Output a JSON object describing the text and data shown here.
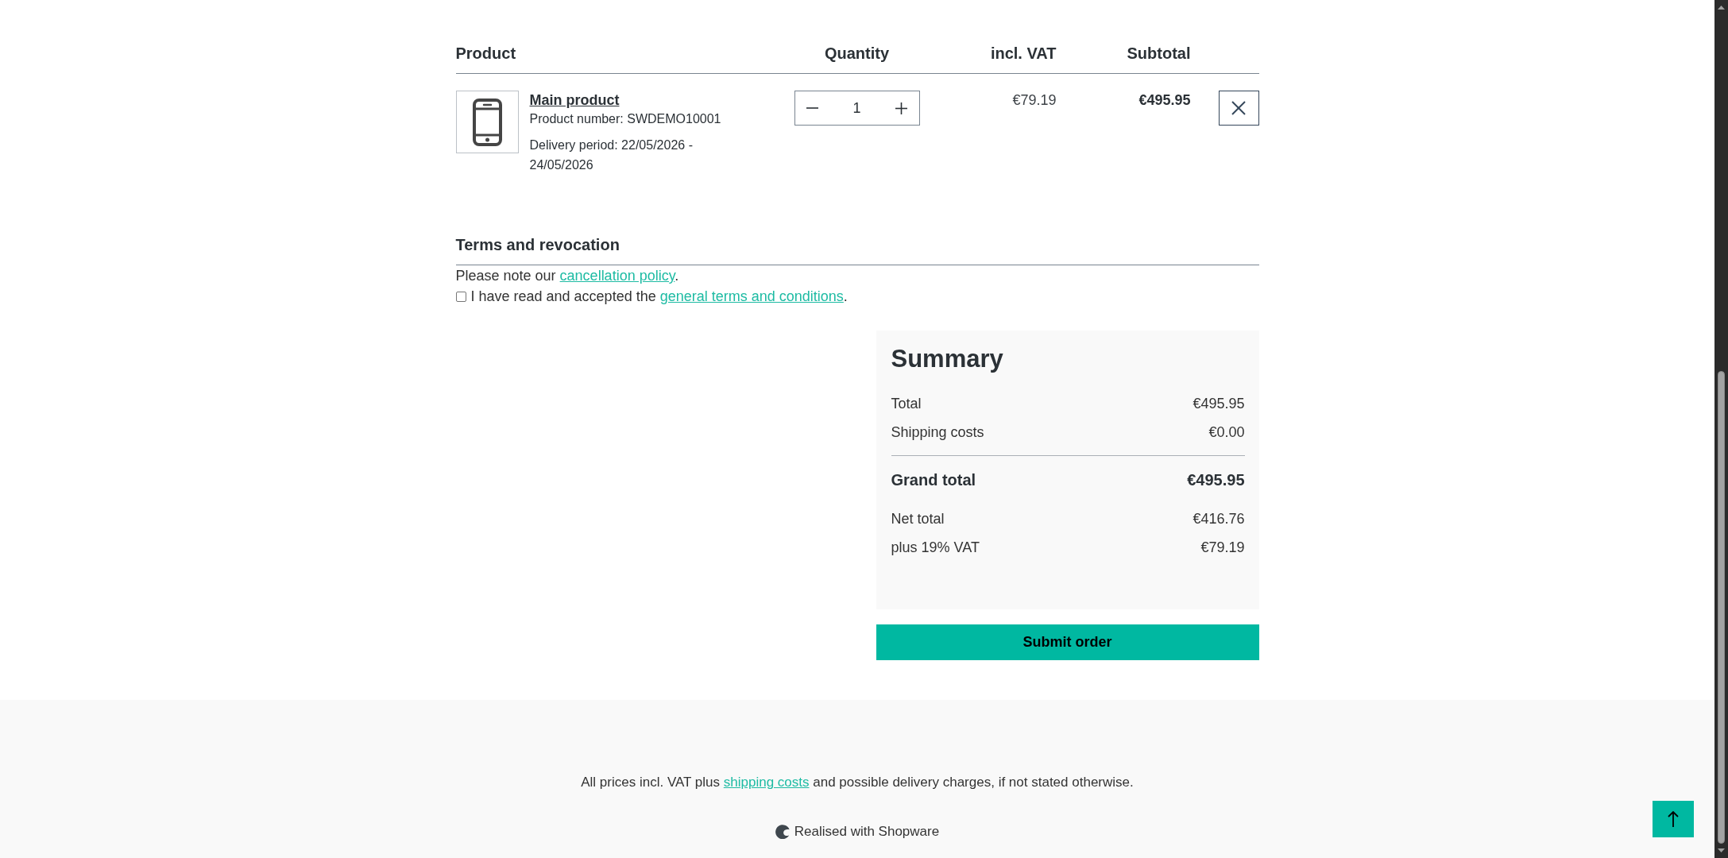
{
  "cart_table": {
    "columns": [
      "Product",
      "Quantity",
      "incl. VAT",
      "Subtotal"
    ],
    "items": [
      {
        "name": "Main product",
        "product_number": "Product number: SWDEMO10001",
        "delivery_period": "Delivery period: 22/05/2026 - 24/05/2026",
        "quantity": "1",
        "price_incl_vat": "€79.19",
        "subtotal": "€495.95"
      }
    ]
  },
  "terms": {
    "title": "Terms and revocation",
    "notice": {
      "before": "Please note our ",
      "link": "cancellation policy",
      "after": "."
    },
    "acceptance": {
      "checked": false,
      "before": "I have read and accepted the ",
      "link": "general terms and conditions",
      "after": "."
    }
  },
  "summary": {
    "title": "Summary",
    "rows": [
      {
        "kind": "line",
        "label": "Total",
        "value": "€495.95"
      },
      {
        "kind": "line",
        "label": "Shipping costs",
        "value": "€0.00"
      },
      {
        "kind": "grand",
        "label": "Grand total",
        "value": "€495.95"
      },
      {
        "kind": "line",
        "label": "Net total",
        "value": "€416.76"
      },
      {
        "kind": "line",
        "label": "plus 19% VAT",
        "value": "€79.19"
      }
    ]
  },
  "submit_button": "Submit order",
  "footer": {
    "notice": {
      "before": "All prices incl. VAT plus ",
      "link": "shipping costs",
      "after": " and possible delivery charges, if not stated otherwise."
    },
    "credit": "Realised with Shopware"
  }
}
